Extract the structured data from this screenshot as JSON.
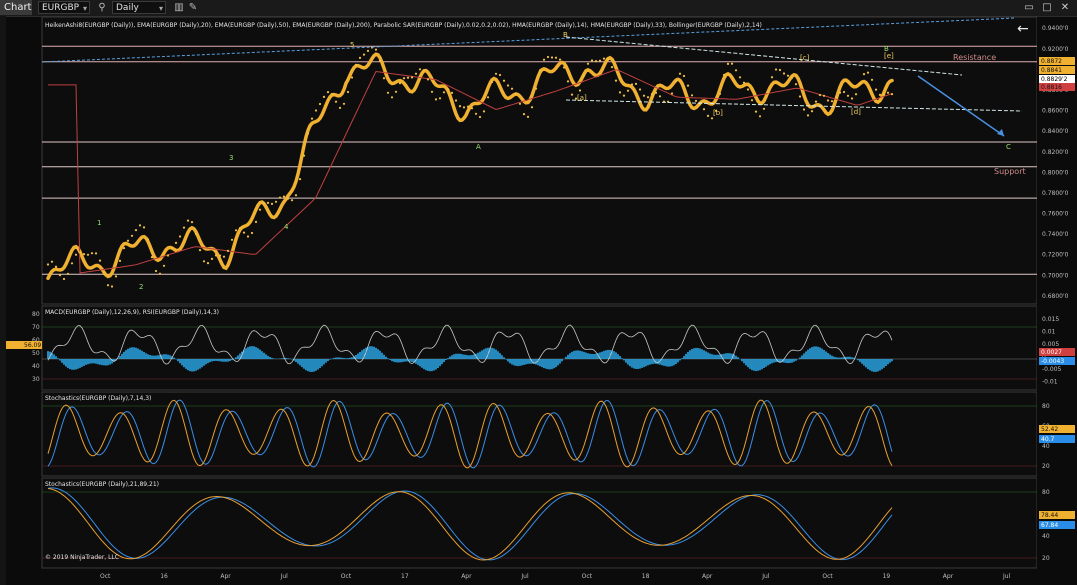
{
  "window": {
    "tab": "Chart",
    "instrument": "EURGBP",
    "interval": "Daily"
  },
  "icons": {
    "search": "search-icon",
    "dropdown": "chevron-down-icon",
    "back": "arrow-left-icon",
    "window_controls": [
      "toolbar-icon",
      "maximize-icon",
      "close-icon"
    ]
  },
  "colors": {
    "background": "#0b0b0b",
    "price_line": "#f0b030",
    "macd_hist": "#2aa8e8",
    "resistance": "#d08080",
    "trend_line": "#9ad0e0",
    "blue_line": "#3a8ee8",
    "orange_line": "#e8a030"
  },
  "chart_data": [
    {
      "type": "line",
      "title": "HeikenAshi8(EURGBP (Daily)), EMA(EURGBP (Daily),20), EMA(EURGBP (Daily),50), EMA(EURGBP (Daily),200), Parabolic SAR(EURGBP (Daily),0.02,0.2,0.02), HMA(EURGBP (Daily),14), HMA(EURGBP (Daily),33), Bollinger(EURGBP (Daily),2,14)",
      "x_ticks": [
        "Oct",
        "16",
        "Apr",
        "Jul",
        "Oct",
        "17",
        "Apr",
        "Jul",
        "Oct",
        "18",
        "Apr",
        "Jul",
        "Oct",
        "19",
        "Apr",
        "Jul"
      ],
      "y_ticks": [
        "0.9400'0",
        "0.9200'0",
        "0.9000'0",
        "0.8800'0",
        "0.8600'0",
        "0.8400'0",
        "0.8200'0",
        "0.8000'0",
        "0.7800'0",
        "0.7600'0",
        "0.7400'0",
        "0.7200'0",
        "0.7000'0",
        "0.6800'0"
      ],
      "ylim": [
        0.676,
        0.948
      ],
      "x": [
        "Oct",
        "16",
        "Apr",
        "Jul",
        "Oct",
        "17",
        "Apr",
        "Jul",
        "Oct",
        "18",
        "Apr",
        "Jul",
        "Oct",
        "19"
      ],
      "series": [
        {
          "values": [
            0.714,
            0.732,
            0.724,
            0.779,
            0.902,
            0.894,
            0.865,
            0.883,
            0.904,
            0.877,
            0.875,
            0.886,
            0.869,
            0.889
          ]
        }
      ],
      "horizontal_levels": [
        0.9225,
        0.9075,
        0.8295,
        0.8055,
        0.775,
        0.701
      ],
      "level_labels": [
        "Resistance",
        "Support"
      ],
      "wave_labels": [
        "1",
        "2",
        "3",
        "4",
        "5",
        "A",
        "B",
        "[a]",
        "[b]",
        "[c]",
        "[d]",
        "[e]",
        "C",
        "B"
      ],
      "price_badges": [
        "0.8872",
        "0.8841",
        "0.8829'2",
        "0.8816"
      ]
    },
    {
      "type": "line",
      "title": "MACD(EURGBP (Daily),12,26,9), RSI(EURGBP (Daily),14,3)",
      "y_ticks_left": [
        "80",
        "70",
        "60",
        "50",
        "40",
        "30"
      ],
      "y_ticks_right": [
        "0.015",
        "0.01",
        "0.005",
        "0",
        "-0.005",
        "-0.01"
      ],
      "current_values": [
        "56.09",
        "0.0027",
        "-0.0043"
      ]
    },
    {
      "type": "line",
      "title": "Stochastics(EURGBP (Daily),7,14,3)",
      "y_ticks": [
        "80",
        "60",
        "40",
        "20"
      ],
      "current_values": [
        "52.42",
        "40.7"
      ]
    },
    {
      "type": "line",
      "title": "Stochastics(EURGBP (Daily),21,89,21)",
      "y_ticks": [
        "80",
        "60",
        "40",
        "20"
      ],
      "current_values": [
        "78.44",
        "67.84"
      ]
    }
  ],
  "footer": {
    "copyright": "© 2019 NinjaTrader, LLC"
  }
}
